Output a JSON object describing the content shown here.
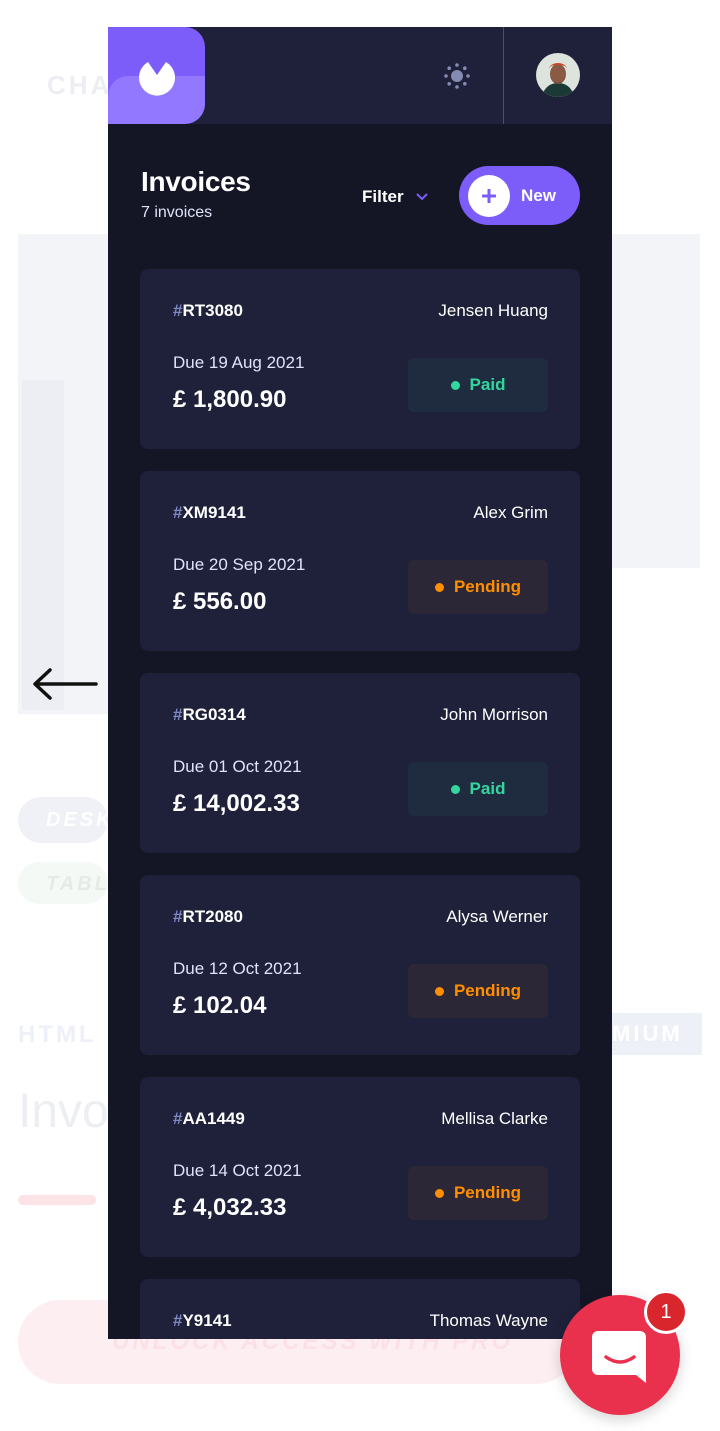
{
  "background": {
    "heading": "CHA",
    "word_html": "HTML",
    "word_premium": "MIUM",
    "big_word": "Invo",
    "pill_desk": "DESK",
    "pill_tab": "TABL",
    "cta": "UNLOCK ACCESS WITH PRO"
  },
  "header": {
    "title": "Invoices",
    "subtitle": "7 invoices",
    "filter_label": "Filter",
    "new_label": "New"
  },
  "invoices": [
    {
      "hash": "#",
      "id": "RT3080",
      "client": "Jensen Huang",
      "due": "Due  19 Aug 2021",
      "amount": "£ 1,800.90",
      "status": "Paid"
    },
    {
      "hash": "#",
      "id": "XM9141",
      "client": "Alex Grim",
      "due": "Due  20 Sep 2021",
      "amount": "£ 556.00",
      "status": "Pending"
    },
    {
      "hash": "#",
      "id": "RG0314",
      "client": "John Morrison",
      "due": "Due  01 Oct 2021",
      "amount": "£ 14,002.33",
      "status": "Paid"
    },
    {
      "hash": "#",
      "id": "RT2080",
      "client": "Alysa Werner",
      "due": "Due  12 Oct 2021",
      "amount": "£ 102.04",
      "status": "Pending"
    },
    {
      "hash": "#",
      "id": "AA1449",
      "client": "Mellisa Clarke",
      "due": "Due  14 Oct 2021",
      "amount": "£ 4,032.33",
      "status": "Pending"
    },
    {
      "hash": "#",
      "id": "Y9141",
      "client": "Thomas Wayne",
      "due": "",
      "amount": "",
      "status": ""
    }
  ],
  "chat": {
    "badge_count": "1"
  },
  "colors": {
    "accent": "#7c5dfa",
    "paid": "#33d69f",
    "pending": "#ff8f00",
    "chat": "#e9314e"
  }
}
